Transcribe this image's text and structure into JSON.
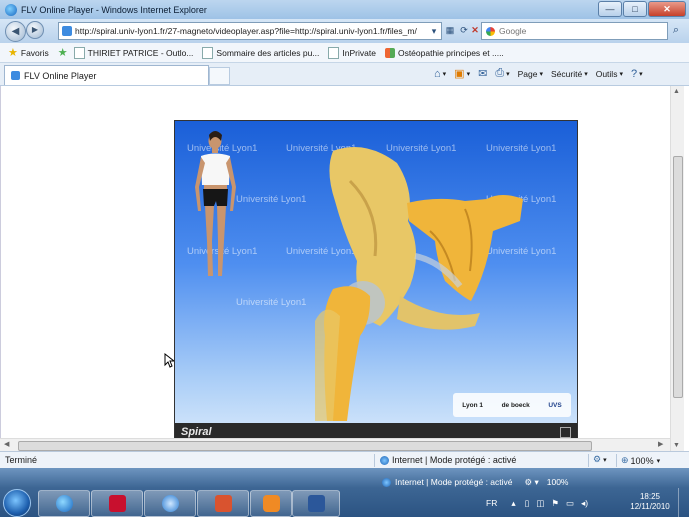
{
  "window": {
    "title": "FLV Online Player - Windows Internet Explorer",
    "controls": {
      "minimize": "—",
      "maximize": "□",
      "close": "✕"
    }
  },
  "navbar": {
    "back_icon": "◀",
    "forward_icon": "▶",
    "address": "http://spiral.univ-lyon1.fr/27-magneto/videoplayer.asp?file=http://spiral.univ-lyon1.fr/files_m/",
    "refresh_icon": "⟳",
    "stop_icon": "✕",
    "search_placeholder": "Google",
    "search_icon": "⌕"
  },
  "favorites_bar": {
    "favorites_label": "Favoris",
    "items": [
      "THIRIET PATRICE - Outlo...",
      "Sommaire des articles pu...",
      "InPrivate",
      "Ostéopathie principes et ....."
    ]
  },
  "tabbar": {
    "tab_title": "FLV Online Player",
    "commands": [
      "Page",
      "Sécurité",
      "Outils"
    ]
  },
  "player": {
    "watermark": "Université Lyon1",
    "brand": "Spiral",
    "logos": [
      "Lyon 1",
      "de boeck",
      "UVS"
    ]
  },
  "status_bar": {
    "left_text": "Terminé",
    "zone_text": "Internet | Mode protégé : activé",
    "zoom": "100%"
  },
  "taskbar": {
    "status_text": "Internet | Mode protégé : activé",
    "language": "FR",
    "time": "18:25",
    "date": "12/11/2010",
    "apps": [
      "internet-explorer",
      "acrobat-reader",
      "quicktime",
      "presentation",
      "media-player",
      "word"
    ]
  },
  "colors": {
    "titlebar": "#9ec2e6",
    "taskbar": "#2b5382",
    "player_top": "#1a5fd8",
    "bone": "#e9c25a"
  }
}
